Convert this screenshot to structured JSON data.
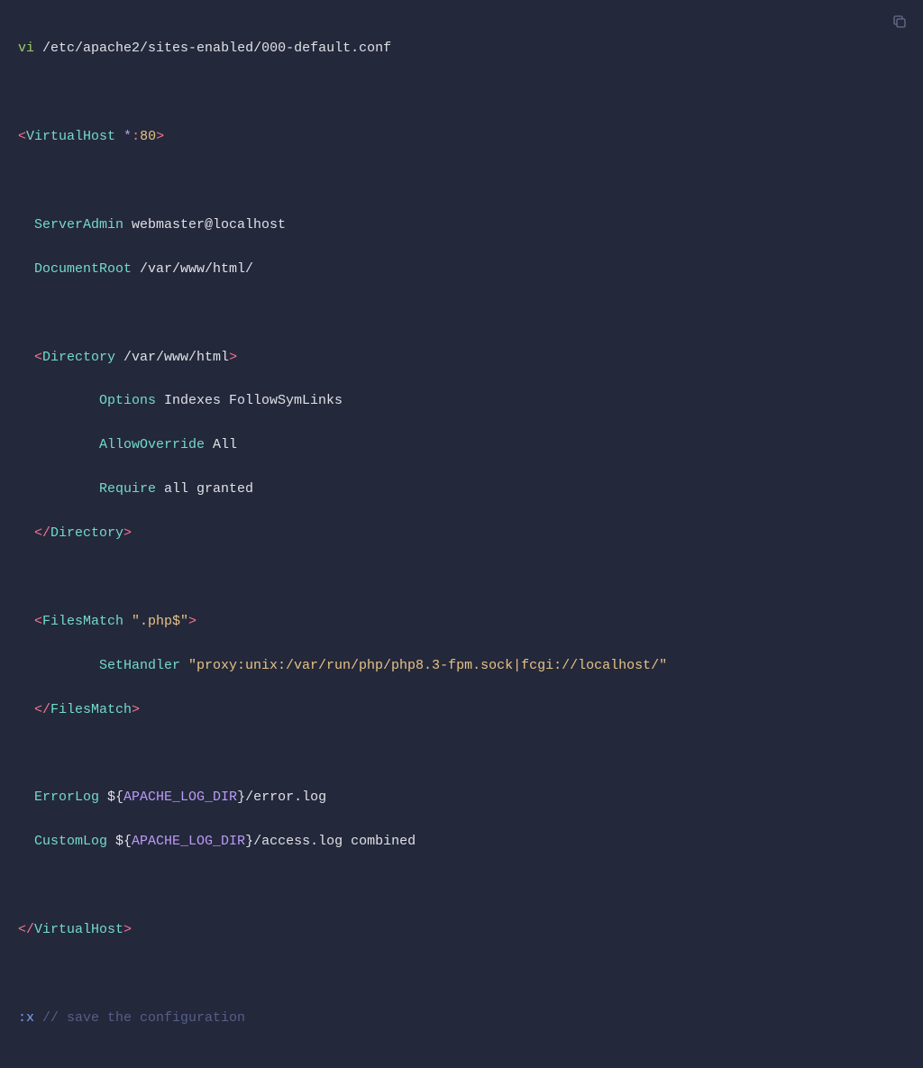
{
  "cmd": {
    "vi": "vi",
    "path": "/etc/apache2/sites-enabled/000-default.conf"
  },
  "vhost_open": {
    "lt": "<",
    "tag": "VirtualHost",
    "star": " *",
    "colon": ":",
    "port": "80",
    "gt": ">"
  },
  "server_admin": {
    "key": "ServerAdmin",
    "val": " webmaster@localhost"
  },
  "doc_root": {
    "key": "DocumentRoot",
    "val": " /var/www/html/"
  },
  "dir_open": {
    "lt": "<",
    "tag": "Directory",
    "path": " /var/www/html",
    "gt": ">"
  },
  "options": {
    "key": "Options",
    "val": " Indexes FollowSymLinks"
  },
  "allow_override": {
    "key": "AllowOverride",
    "val": " All"
  },
  "require": {
    "key": "Require",
    "val": " all granted"
  },
  "dir_close": {
    "lt": "</",
    "tag": "Directory",
    "gt": ">"
  },
  "files_open": {
    "lt": "<",
    "tag": "FilesMatch",
    "str": " \".php$\"",
    "gt": ">"
  },
  "set_handler": {
    "key": "SetHandler",
    "val": " \"proxy:unix:/var/run/php/php8.3-fpm.sock|fcgi://localhost/\""
  },
  "files_close": {
    "lt": "</",
    "tag": "FilesMatch",
    "gt": ">"
  },
  "error_log": {
    "key": "ErrorLog",
    "d1": " ${",
    "var": "APACHE_LOG_DIR",
    "d2": "}",
    "rest": "/error.log"
  },
  "custom_log": {
    "key": "CustomLog",
    "d1": " ${",
    "var": "APACHE_LOG_DIR",
    "d2": "}",
    "rest": "/access.log combined"
  },
  "vhost_close": {
    "lt": "</",
    "tag": "VirtualHost",
    "gt": ">"
  },
  "save": {
    "cmd": ":x",
    "comment": " // save the configuration"
  }
}
